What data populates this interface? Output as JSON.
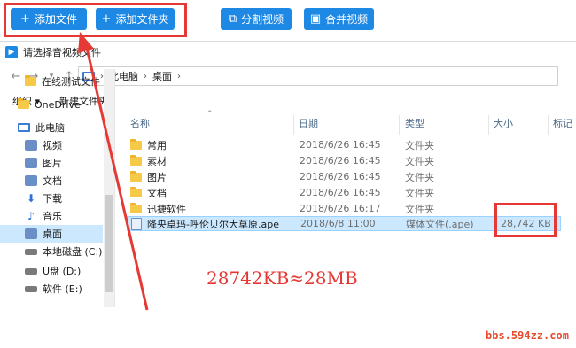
{
  "toolbar": {
    "add_file": "添加文件",
    "add_folder": "添加文件夹",
    "split_video": "分割视频",
    "merge_video": "合并视频"
  },
  "dialog": {
    "title": "请选择音视频文件",
    "breadcrumb": [
      "此电脑",
      "桌面"
    ],
    "organize": "组织",
    "new_folder": "新建文件夹"
  },
  "nav": {
    "items": [
      {
        "label": "在线测试文件",
        "icon": "folder-icon"
      },
      {
        "label": "OneDrive",
        "icon": "onedrive-icon"
      },
      {
        "label": "此电脑",
        "icon": "pc-icon"
      },
      {
        "label": "视频",
        "icon": "video-folder-icon"
      },
      {
        "label": "图片",
        "icon": "pictures-folder-icon"
      },
      {
        "label": "文档",
        "icon": "documents-folder-icon"
      },
      {
        "label": "下载",
        "icon": "download-icon"
      },
      {
        "label": "音乐",
        "icon": "music-icon"
      },
      {
        "label": "桌面",
        "icon": "desktop-icon"
      },
      {
        "label": "本地磁盘 (C:)",
        "icon": "disk-icon"
      },
      {
        "label": "U盘 (D:)",
        "icon": "usb-icon"
      },
      {
        "label": "软件 (E:)",
        "icon": "disk-icon"
      }
    ]
  },
  "columns": {
    "name": "名称",
    "date": "日期",
    "type": "类型",
    "size": "大小",
    "tag": "标记"
  },
  "files": [
    {
      "name": "常用",
      "date": "2018/6/26 16:45",
      "type": "文件夹",
      "size": ""
    },
    {
      "name": "素材",
      "date": "2018/6/26 16:45",
      "type": "文件夹",
      "size": ""
    },
    {
      "name": "图片",
      "date": "2018/6/26 16:45",
      "type": "文件夹",
      "size": ""
    },
    {
      "name": "文档",
      "date": "2018/6/26 16:45",
      "type": "文件夹",
      "size": ""
    },
    {
      "name": "迅捷软件",
      "date": "2018/6/26 16:17",
      "type": "文件夹",
      "size": ""
    },
    {
      "name": "降央卓玛-呼伦贝尔大草原.ape",
      "date": "2018/6/8 11:00",
      "type": "媒体文件(.ape)",
      "size": "28,742 KB"
    }
  ],
  "annotation": "28742KB≈28MB",
  "watermark": "bbs.594zz.com",
  "colors": {
    "accent": "#1e88e5",
    "highlight": "#e53935",
    "selection": "#cce8ff"
  }
}
